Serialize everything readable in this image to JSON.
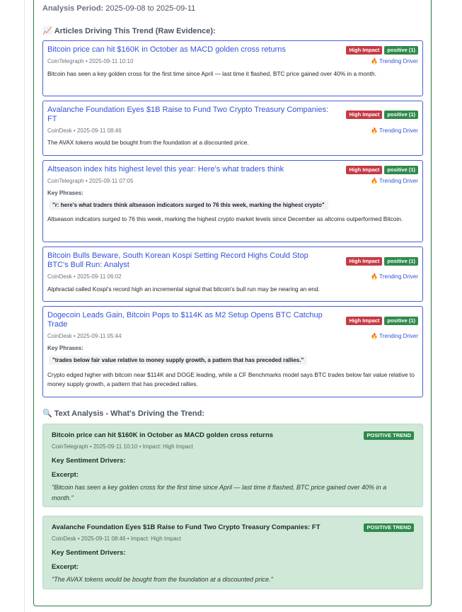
{
  "analysis_period": {
    "label": "Analysis Period:",
    "value": "2025-09-08 to 2025-09-11"
  },
  "articles_section": {
    "icon": "📈",
    "title": "Articles Driving This Trend (Raw Evidence):"
  },
  "articles": [
    {
      "title": "Bitcoin price can hit $160K in October as MACD golden cross returns",
      "impact": "High Impact",
      "sentiment": "positive (1)",
      "source": "CoinTelegraph",
      "time": "2025-09-11 10:10",
      "driver": "Trending Driver",
      "summary": "Bitcoin has seen a key golden cross for the first time since April — last time it flashed, BTC price gained over 40% in a month."
    },
    {
      "title": "Avalanche Foundation Eyes $1B Raise to Fund Two Crypto Treasury Companies: FT",
      "impact": "High Impact",
      "sentiment": "positive (1)",
      "source": "CoinDesk",
      "time": "2025-09-11 08:46",
      "driver": "Trending Driver",
      "summary": "The AVAX tokens would be bought from the foundation at a discounted price."
    },
    {
      "title": "Altseason index hits highest level this year: Here's what traders think",
      "impact": "High Impact",
      "sentiment": "positive (1)",
      "source": "CoinTelegraph",
      "time": "2025-09-11 07:05",
      "driver": "Trending Driver",
      "key_phrases_label": "Key Phrases:",
      "key_phrase": "\"r: here's what traders think altseason indicators surged to 76 this week, marking the highest crypto\"",
      "summary": "Altseason indicators surged to 76 this week, marking the highest crypto market levels since December as altcoins outperformed Bitcoin."
    },
    {
      "title": "Bitcoin Bulls Beware, South Korean Kospi Setting Record Highs Could Stop BTC's Bull Run: Analyst",
      "impact": "High Impact",
      "sentiment": "positive (1)",
      "source": "CoinDesk",
      "time": "2025-09-11 06:02",
      "driver": "Trending Driver",
      "summary": "Alphractal called Kospi's record high an incremental signal that bitcoin's bull run may be nearing an end."
    },
    {
      "title": "Dogecoin Leads Gain, Bitcoin Pops to $114K as M2 Setup Opens BTC Catchup Trade",
      "impact": "High Impact",
      "sentiment": "positive (1)",
      "source": "CoinDesk",
      "time": "2025-09-11 05:44",
      "driver": "Trending Driver",
      "key_phrases_label": "Key Phrases:",
      "key_phrase": "\"trades below fair value relative to money supply growth, a pattern that has preceded rallies.\"",
      "summary": "Crypto edged higher with bitcoin near $114K and DOGE leading, while a CF Benchmarks model says BTC trades below fair value relative to money supply growth, a pattern that has preceded rallies."
    }
  ],
  "text_section": {
    "icon": "🔍",
    "title": "Text Analysis - What's Driving the Trend:"
  },
  "text_analysis": [
    {
      "title": "Bitcoin price can hit $160K in October as MACD golden cross returns",
      "badge": "POSITIVE TREND",
      "meta": "CoinTelegraph • 2025-09-11 10:10 • Impact: High Impact",
      "drivers_label": "Key Sentiment Drivers:",
      "excerpt_label": "Excerpt:",
      "excerpt": "\"Bitcoin has seen a key golden cross for the first time since April — last time it flashed, BTC price gained over 40% in a month.\""
    },
    {
      "title": "Avalanche Foundation Eyes $1B Raise to Fund Two Crypto Treasury Companies: FT",
      "badge": "POSITIVE TREND",
      "meta": "CoinDesk • 2025-09-11 08:46 • Impact: High Impact",
      "drivers_label": "Key Sentiment Drivers:",
      "excerpt_label": "Excerpt:",
      "excerpt": "\"The AVAX tokens would be bought from the foundation at a discounted price.\""
    }
  ],
  "separator": "•",
  "colors": {
    "accent_border": "#2f7a45",
    "link": "#3452d6",
    "high_impact": "#c53b44",
    "positive": "#2f8a4c",
    "trend_bg": "#cfe8d7"
  }
}
